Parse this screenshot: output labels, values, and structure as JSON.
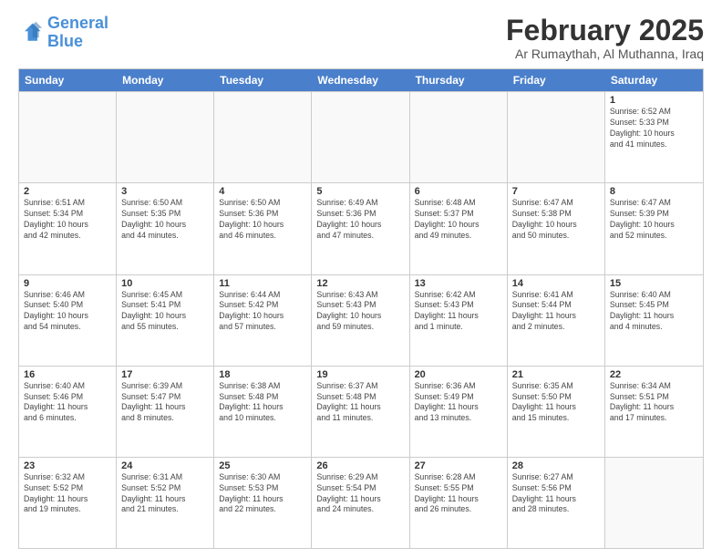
{
  "logo": {
    "line1": "General",
    "line2": "Blue"
  },
  "title": "February 2025",
  "subtitle": "Ar Rumaythah, Al Muthanna, Iraq",
  "days": [
    "Sunday",
    "Monday",
    "Tuesday",
    "Wednesday",
    "Thursday",
    "Friday",
    "Saturday"
  ],
  "weeks": [
    [
      {
        "day": "",
        "info": ""
      },
      {
        "day": "",
        "info": ""
      },
      {
        "day": "",
        "info": ""
      },
      {
        "day": "",
        "info": ""
      },
      {
        "day": "",
        "info": ""
      },
      {
        "day": "",
        "info": ""
      },
      {
        "day": "1",
        "info": "Sunrise: 6:52 AM\nSunset: 5:33 PM\nDaylight: 10 hours\nand 41 minutes."
      }
    ],
    [
      {
        "day": "2",
        "info": "Sunrise: 6:51 AM\nSunset: 5:34 PM\nDaylight: 10 hours\nand 42 minutes."
      },
      {
        "day": "3",
        "info": "Sunrise: 6:50 AM\nSunset: 5:35 PM\nDaylight: 10 hours\nand 44 minutes."
      },
      {
        "day": "4",
        "info": "Sunrise: 6:50 AM\nSunset: 5:36 PM\nDaylight: 10 hours\nand 46 minutes."
      },
      {
        "day": "5",
        "info": "Sunrise: 6:49 AM\nSunset: 5:36 PM\nDaylight: 10 hours\nand 47 minutes."
      },
      {
        "day": "6",
        "info": "Sunrise: 6:48 AM\nSunset: 5:37 PM\nDaylight: 10 hours\nand 49 minutes."
      },
      {
        "day": "7",
        "info": "Sunrise: 6:47 AM\nSunset: 5:38 PM\nDaylight: 10 hours\nand 50 minutes."
      },
      {
        "day": "8",
        "info": "Sunrise: 6:47 AM\nSunset: 5:39 PM\nDaylight: 10 hours\nand 52 minutes."
      }
    ],
    [
      {
        "day": "9",
        "info": "Sunrise: 6:46 AM\nSunset: 5:40 PM\nDaylight: 10 hours\nand 54 minutes."
      },
      {
        "day": "10",
        "info": "Sunrise: 6:45 AM\nSunset: 5:41 PM\nDaylight: 10 hours\nand 55 minutes."
      },
      {
        "day": "11",
        "info": "Sunrise: 6:44 AM\nSunset: 5:42 PM\nDaylight: 10 hours\nand 57 minutes."
      },
      {
        "day": "12",
        "info": "Sunrise: 6:43 AM\nSunset: 5:43 PM\nDaylight: 10 hours\nand 59 minutes."
      },
      {
        "day": "13",
        "info": "Sunrise: 6:42 AM\nSunset: 5:43 PM\nDaylight: 11 hours\nand 1 minute."
      },
      {
        "day": "14",
        "info": "Sunrise: 6:41 AM\nSunset: 5:44 PM\nDaylight: 11 hours\nand 2 minutes."
      },
      {
        "day": "15",
        "info": "Sunrise: 6:40 AM\nSunset: 5:45 PM\nDaylight: 11 hours\nand 4 minutes."
      }
    ],
    [
      {
        "day": "16",
        "info": "Sunrise: 6:40 AM\nSunset: 5:46 PM\nDaylight: 11 hours\nand 6 minutes."
      },
      {
        "day": "17",
        "info": "Sunrise: 6:39 AM\nSunset: 5:47 PM\nDaylight: 11 hours\nand 8 minutes."
      },
      {
        "day": "18",
        "info": "Sunrise: 6:38 AM\nSunset: 5:48 PM\nDaylight: 11 hours\nand 10 minutes."
      },
      {
        "day": "19",
        "info": "Sunrise: 6:37 AM\nSunset: 5:48 PM\nDaylight: 11 hours\nand 11 minutes."
      },
      {
        "day": "20",
        "info": "Sunrise: 6:36 AM\nSunset: 5:49 PM\nDaylight: 11 hours\nand 13 minutes."
      },
      {
        "day": "21",
        "info": "Sunrise: 6:35 AM\nSunset: 5:50 PM\nDaylight: 11 hours\nand 15 minutes."
      },
      {
        "day": "22",
        "info": "Sunrise: 6:34 AM\nSunset: 5:51 PM\nDaylight: 11 hours\nand 17 minutes."
      }
    ],
    [
      {
        "day": "23",
        "info": "Sunrise: 6:32 AM\nSunset: 5:52 PM\nDaylight: 11 hours\nand 19 minutes."
      },
      {
        "day": "24",
        "info": "Sunrise: 6:31 AM\nSunset: 5:52 PM\nDaylight: 11 hours\nand 21 minutes."
      },
      {
        "day": "25",
        "info": "Sunrise: 6:30 AM\nSunset: 5:53 PM\nDaylight: 11 hours\nand 22 minutes."
      },
      {
        "day": "26",
        "info": "Sunrise: 6:29 AM\nSunset: 5:54 PM\nDaylight: 11 hours\nand 24 minutes."
      },
      {
        "day": "27",
        "info": "Sunrise: 6:28 AM\nSunset: 5:55 PM\nDaylight: 11 hours\nand 26 minutes."
      },
      {
        "day": "28",
        "info": "Sunrise: 6:27 AM\nSunset: 5:56 PM\nDaylight: 11 hours\nand 28 minutes."
      },
      {
        "day": "",
        "info": ""
      }
    ]
  ]
}
